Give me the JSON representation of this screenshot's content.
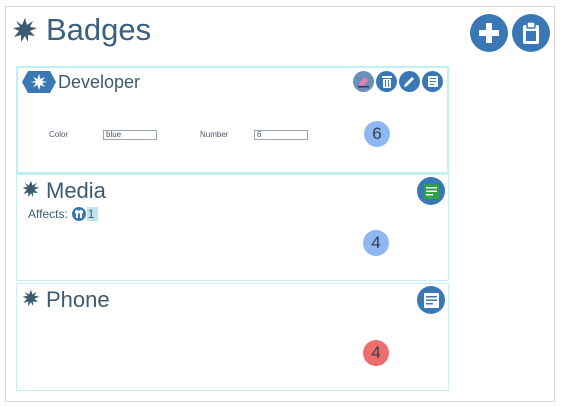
{
  "page": {
    "title": "Badges"
  },
  "toolbar": {
    "add_icon": "plus-icon",
    "clipboard_icon": "clipboard-icon"
  },
  "badges": [
    {
      "name": "Developer",
      "fields": {
        "color_label": "Color",
        "color_value": "blue",
        "number_label": "Number",
        "number_value": "6"
      },
      "count": "6",
      "count_color": "#8fb8f0",
      "actions": [
        "eraser-icon",
        "trash-icon",
        "edit-icon",
        "list-icon"
      ]
    },
    {
      "name": "Media",
      "affects_label": "Affects:",
      "affects_value": "1",
      "count": "4",
      "count_color": "#8fb8f0",
      "note_color": "#2e9e4f"
    },
    {
      "name": "Phone",
      "count": "4",
      "count_color": "#ee6e6e",
      "note_color": "#3a78b5"
    }
  ]
}
